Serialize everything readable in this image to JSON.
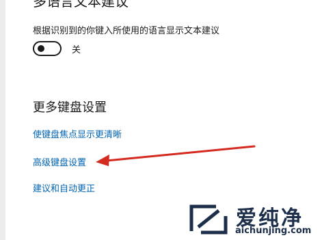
{
  "multilang": {
    "title": "多语言文本建议",
    "description": "根据识别到的你键入所使用的语言显示文本建议",
    "toggle_state": "关",
    "toggle_on": false
  },
  "more_keyboard": {
    "title": "更多键盘设置",
    "links": [
      "使键盘焦点显示更清晰",
      "高级键盘设置",
      "建议和自动更正"
    ]
  },
  "annotation": {
    "arrow_color": "#d42a20"
  },
  "watermark": {
    "name": "爱纯净",
    "url": "aichunjing.com",
    "color": "#1c2e4a"
  }
}
